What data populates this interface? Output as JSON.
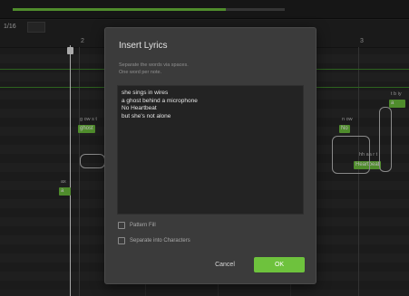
{
  "editor": {
    "snap_value": "1/16",
    "ruler": {
      "bar_2": "2",
      "bar_3": "3"
    },
    "notes": {
      "ghost": {
        "lyric": "ghost",
        "phonemes": "g ow s t"
      },
      "a": {
        "lyric": "a",
        "phonemes": "ax"
      },
      "no": {
        "lyric": "No",
        "phonemes": "n ow"
      },
      "heartbeat": {
        "lyric": "Heartbeat",
        "phonemes": "hh aa r t"
      },
      "right_top": {
        "lyric": "a",
        "phonemes": "t b iy"
      }
    },
    "colors": {
      "accent": "#6ec23d",
      "background": "#2a2a2a"
    }
  },
  "dialog": {
    "title": "Insert Lyrics",
    "hint": "Separate the words via spaces.\nOne word per note.",
    "lyrics_text": "she sings in wires\na ghost behind a microphone\nNo Heartbeat\nbut she's not alone",
    "options": {
      "pattern_fill": "Pattern Fill",
      "separate_characters": "Separate into Characters"
    },
    "buttons": {
      "cancel": "Cancel",
      "ok": "OK"
    }
  }
}
